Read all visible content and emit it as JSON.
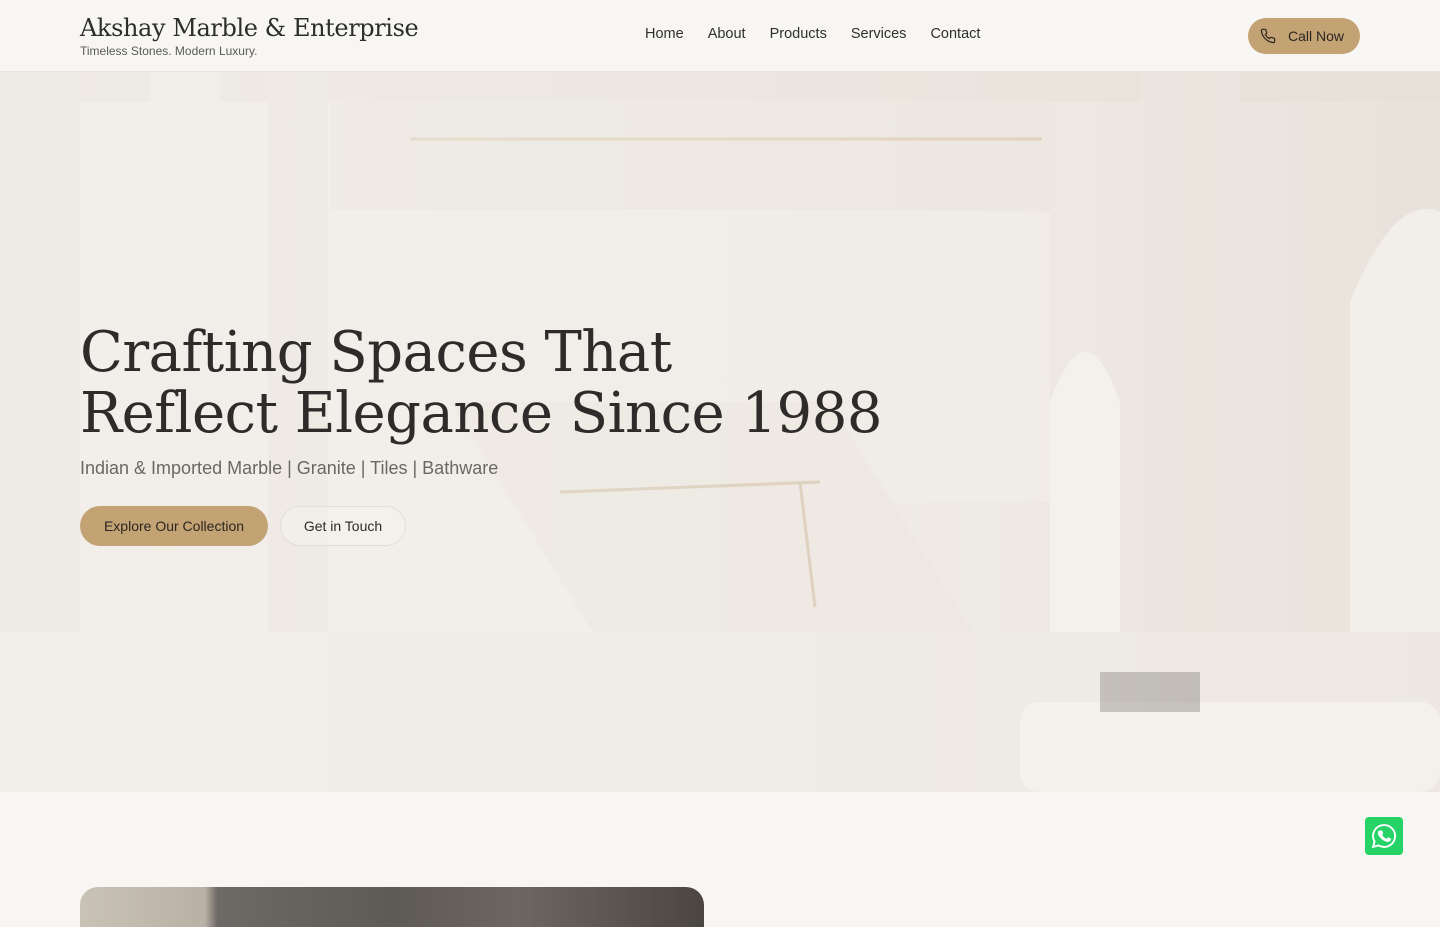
{
  "header": {
    "brand_name": "Akshay Marble & Enterprise",
    "tagline": "Timeless Stones. Modern Luxury.",
    "nav": [
      "Home",
      "About",
      "Products",
      "Services",
      "Contact"
    ],
    "call_label": "Call Now",
    "call_icon": "phone-icon"
  },
  "hero": {
    "title_line1": "Crafting Spaces That",
    "title_line2": "Reflect Elegance Since 1988",
    "subtitle": "Indian & Imported Marble | Granite | Tiles | Bathware",
    "primary_button": "Explore Our Collection",
    "secondary_button": "Get in Touch"
  },
  "floating": {
    "whatsapp_icon": "whatsapp-icon"
  },
  "colors": {
    "accent": "#c3a374",
    "background": "#f8f6f2",
    "text": "#2e2c2a",
    "whatsapp": "#25d366"
  }
}
